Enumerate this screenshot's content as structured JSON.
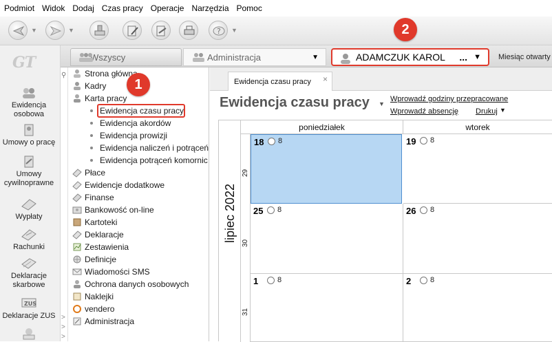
{
  "menu": [
    "Podmiot",
    "Widok",
    "Dodaj",
    "Czas pracy",
    "Operacje",
    "Narzędzia",
    "Pomoc"
  ],
  "toolbar": {
    "icons": [
      "back-icon",
      "forward-icon",
      "stamp-icon",
      "document-edit-icon",
      "document-sign-icon",
      "printer-icon",
      "help-icon"
    ]
  },
  "badges": {
    "first": "1",
    "second": "2"
  },
  "app_logo": "GT",
  "header": {
    "all_label": "Wszyscy",
    "admin_label": "Administracja",
    "employee_name": "ADAMCZUK KAROL",
    "employee_more": "...",
    "month_status": "Miesiąc otwarty"
  },
  "nav": [
    {
      "label": "Ewidencja osobowa",
      "icon": "people-icon"
    },
    {
      "label": "Umowy o pracę",
      "icon": "contract-icon"
    },
    {
      "label": "Umowy cywilnoprawne",
      "icon": "civil-contract-icon"
    },
    {
      "label": "Wypłaty",
      "icon": "payout-icon"
    },
    {
      "label": "Rachunki",
      "icon": "bill-icon"
    },
    {
      "label": "Deklaracje skarbowe",
      "icon": "tax-declaration-icon"
    },
    {
      "label": "Deklaracje ZUS",
      "icon": "zus-icon"
    }
  ],
  "tree": {
    "top": [
      "Strona główna",
      "Kadry",
      "Karta pracy"
    ],
    "sub": [
      "Ewidencja czasu pracy",
      "Ewidencja akordów",
      "Ewidencja prowizji",
      "Ewidencja naliczeń i potrąceń",
      "Ewidencja potrąceń komornic"
    ],
    "bottom": [
      "Płace",
      "Ewidencje dodatkowe",
      "Finanse",
      "Bankowość on-line",
      "Kartoteki",
      "Deklaracje",
      "Zestawienia",
      "Definicje",
      "Wiadomości SMS",
      "Ochrona danych osobowych",
      "Naklejki",
      "vendero",
      "Administracja"
    ]
  },
  "doc_tab": {
    "label": "Ewidencja czasu pracy",
    "close": "×"
  },
  "page": {
    "title": "Ewidencja czasu pracy",
    "link_hours": "Wprowadź godziny przepracowane",
    "link_absence": "Wprowadź absencję",
    "link_print": "Drukuj"
  },
  "calendar": {
    "month_label": "lipiec 2022",
    "days": [
      "poniedziałek",
      "wtorek"
    ],
    "weeks": [
      {
        "num": "29",
        "cells": [
          {
            "day": "18",
            "hours": "8"
          },
          {
            "day": "19",
            "hours": "8"
          }
        ]
      },
      {
        "num": "30",
        "cells": [
          {
            "day": "25",
            "hours": "8"
          },
          {
            "day": "26",
            "hours": "8"
          }
        ]
      },
      {
        "num": "31",
        "cells": [
          {
            "day": "1",
            "hours": "8"
          },
          {
            "day": "2",
            "hours": "8"
          }
        ]
      }
    ]
  },
  "colors": {
    "accent_red": "#e0392b",
    "selected_cell": "#b7d7f3"
  }
}
